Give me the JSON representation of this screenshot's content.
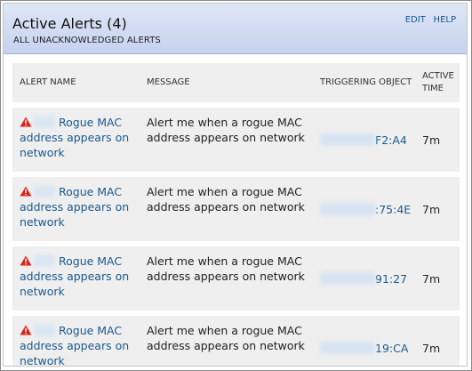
{
  "header": {
    "title": "Active Alerts (4)",
    "subtitle": "ALL UNACKNOWLEDGED ALERTS",
    "edit_label": "EDIT",
    "help_label": "HELP"
  },
  "table": {
    "columns": [
      "ALERT NAME",
      "MESSAGE",
      "TRIGGERING OBJECT",
      "ACTIVE TIME"
    ],
    "rows": [
      {
        "alert_name": "Rogue MAC address appears on network",
        "message": "Alert me when a rogue MAC address appears on network",
        "triggering_object": "F2:A4",
        "active_time": "7m"
      },
      {
        "alert_name": "Rogue MAC address appears on network",
        "message": "Alert me when a rogue MAC address appears on network",
        "triggering_object": ":75:4E",
        "active_time": "7m"
      },
      {
        "alert_name": "Rogue MAC address appears on network",
        "message": "Alert me when a rogue MAC address appears on network",
        "triggering_object": "91:27",
        "active_time": "7m"
      },
      {
        "alert_name": "Rogue MAC address appears on network",
        "message": "Alert me when a rogue MAC address appears on network",
        "triggering_object": "19:CA",
        "active_time": "7m"
      }
    ]
  },
  "icons": {
    "alert": "warning-triangle-icon"
  },
  "colors": {
    "link": "#1a5a8f",
    "header_bg": "#c6d3ef",
    "warning": "#d9241b"
  }
}
